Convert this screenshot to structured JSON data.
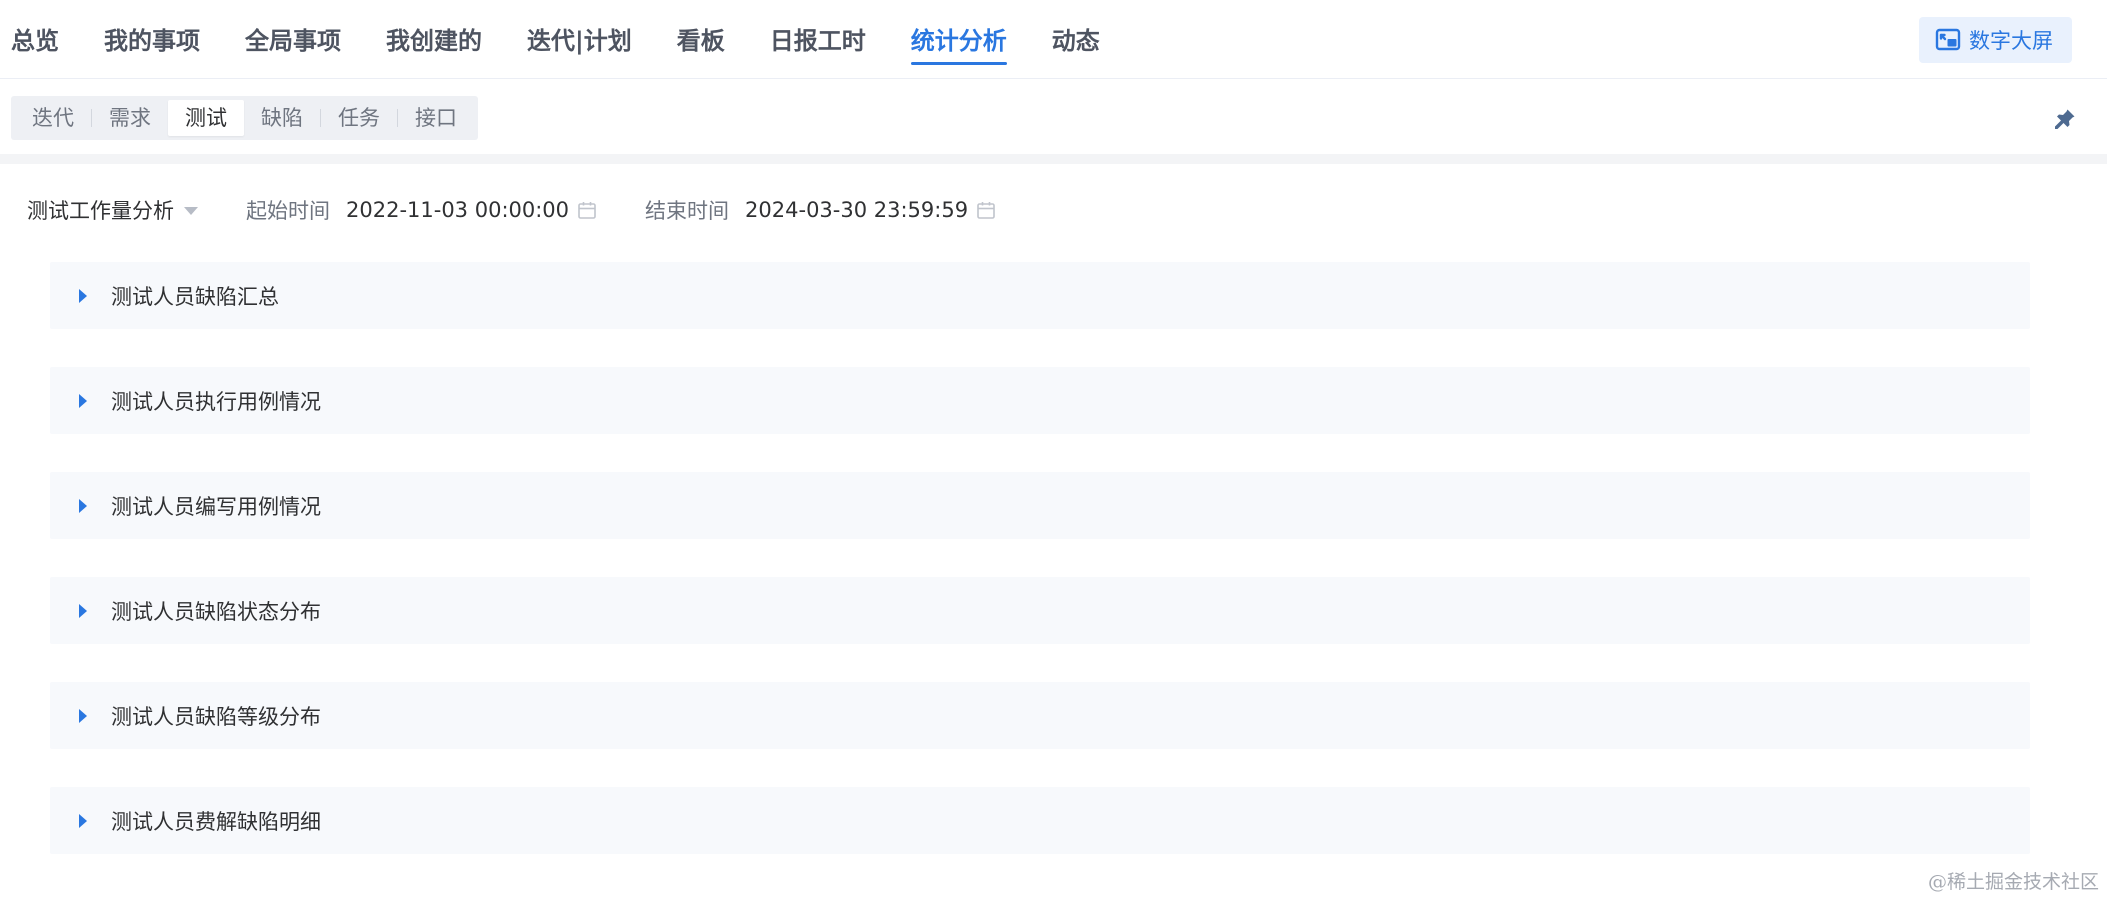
{
  "top_nav": {
    "tabs": [
      {
        "label": "总览"
      },
      {
        "label": "我的事项"
      },
      {
        "label": "全局事项"
      },
      {
        "label": "我创建的"
      },
      {
        "label": "迭代|计划"
      },
      {
        "label": "看板"
      },
      {
        "label": "日报工时"
      },
      {
        "label": "统计分析",
        "active": true
      },
      {
        "label": "动态"
      }
    ],
    "big_screen_label": "数字大屏"
  },
  "sub_nav": {
    "tabs": [
      {
        "label": "迭代"
      },
      {
        "label": "需求"
      },
      {
        "label": "测试",
        "active": true
      },
      {
        "label": "缺陷"
      },
      {
        "label": "任务"
      },
      {
        "label": "接口"
      }
    ]
  },
  "filters": {
    "analysis_type": "测试工作量分析",
    "start_label": "起始时间",
    "start_value": "2022-11-03 00:00:00",
    "end_label": "结束时间",
    "end_value": "2024-03-30 23:59:59"
  },
  "panels": [
    {
      "title": "测试人员缺陷汇总"
    },
    {
      "title": "测试人员执行用例情况"
    },
    {
      "title": "测试人员编写用例情况"
    },
    {
      "title": "测试人员缺陷状态分布"
    },
    {
      "title": "测试人员缺陷等级分布"
    },
    {
      "title": "测试人员费解缺陷明细"
    }
  ],
  "watermark": "@稀土掘金技术社区",
  "colors": {
    "accent": "#2a77e0",
    "panel_bg": "#f7f9fc",
    "button_bg": "#e9f1fd"
  }
}
